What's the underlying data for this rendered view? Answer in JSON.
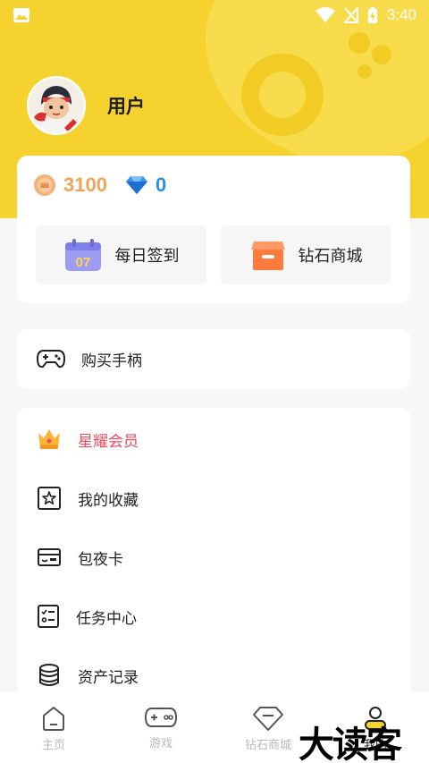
{
  "status_bar": {
    "time": "3:40"
  },
  "profile": {
    "username": "用户"
  },
  "wallet": {
    "coins": "3100",
    "diamonds": "0"
  },
  "quick_actions": {
    "checkin_label": "每日签到",
    "checkin_day": "07",
    "diamond_shop_label": "钻石商城"
  },
  "menu": {
    "buy_controller": "购买手柄",
    "vip": "星耀会员",
    "favorites": "我的收藏",
    "night_pass": "包夜卡",
    "task_center": "任务中心",
    "asset_records": "资产记录"
  },
  "bottom_nav": {
    "home": "主页",
    "games": "游戏",
    "diamond_shop": "钻石商城",
    "mine": "我的"
  },
  "watermark": "大读客",
  "colors": {
    "header": "#f5d22e",
    "vip": "#ef4b5f",
    "coin": "#f0a35a",
    "diamond": "#2f8de8",
    "calendar": "#8c8cf0",
    "box": "#ff8145"
  }
}
